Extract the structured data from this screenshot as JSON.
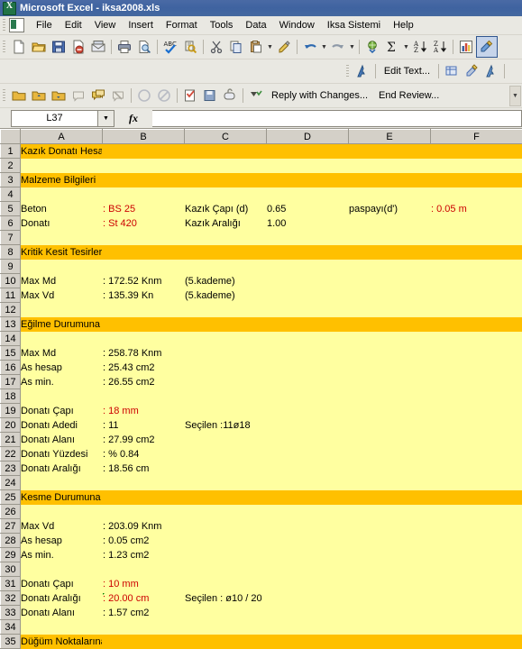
{
  "window": {
    "title": "Microsoft Excel - iksa2008.xls",
    "logo_icon": "excel-logo-icon"
  },
  "menubar": {
    "doc_icon": "document-icon",
    "items": [
      {
        "label": "File"
      },
      {
        "label": "Edit"
      },
      {
        "label": "View"
      },
      {
        "label": "Insert"
      },
      {
        "label": "Format"
      },
      {
        "label": "Tools"
      },
      {
        "label": "Data"
      },
      {
        "label": "Window"
      },
      {
        "label": "Iksa Sistemi"
      },
      {
        "label": "Help"
      }
    ]
  },
  "standard_toolbar": {
    "buttons": [
      {
        "icon": "new-document-icon"
      },
      {
        "icon": "open-folder-icon"
      },
      {
        "icon": "save-icon"
      },
      {
        "icon": "permission-icon"
      },
      {
        "icon": "email-icon"
      },
      {
        "icon": "print-icon"
      },
      {
        "icon": "print-preview-icon"
      },
      {
        "icon": "spelling-check-icon"
      },
      {
        "icon": "research-icon"
      },
      {
        "icon": "cut-scissors-icon"
      },
      {
        "icon": "copy-icon"
      },
      {
        "icon": "paste-icon"
      },
      {
        "icon": "format-painter-icon"
      },
      {
        "icon": "undo-icon"
      },
      {
        "icon": "redo-icon"
      },
      {
        "icon": "hyperlink-icon"
      },
      {
        "icon": "autosum-sigma-icon"
      },
      {
        "icon": "sort-ascending-icon"
      },
      {
        "icon": "sort-descending-icon"
      },
      {
        "icon": "chart-wizard-icon"
      },
      {
        "icon": "drawing-icon"
      }
    ]
  },
  "wordart_toolbar": {
    "shape_icon": "wordart-icon",
    "edit_text_label": "Edit Text...",
    "gallery_icon": "wordart-gallery-icon",
    "format_icon": "format-wordart-icon",
    "shape_letter_icon": "wordart-shape-icon"
  },
  "reviewing_toolbar": {
    "buttons": [
      {
        "icon": "folder-markup-icon"
      },
      {
        "icon": "previous-comment-icon"
      },
      {
        "icon": "next-comment-icon"
      },
      {
        "icon": "show-markup-icon"
      },
      {
        "icon": "comments-icon"
      },
      {
        "icon": "delete-comment-icon"
      },
      {
        "icon": "accept-change-icon"
      },
      {
        "icon": "reject-change-icon"
      },
      {
        "icon": "track-changes-icon"
      },
      {
        "icon": "save-markup-icon"
      },
      {
        "icon": "mail-recipient-icon"
      }
    ],
    "reply_icon": "reply-changes-icon",
    "reply_label": "Reply with Changes...",
    "end_review_label": "End Review..."
  },
  "formula_bar": {
    "name_box_value": "L37",
    "dropdown_icon": "chevron-down-icon",
    "fx_icon": "fx-icon",
    "formula_value": ""
  },
  "sheet": {
    "columns": [
      "A",
      "B",
      "C",
      "D",
      "E",
      "F"
    ],
    "rows": [
      {
        "n": "1",
        "cells": [
          {
            "c": "A",
            "v": "Kazık  Donatı Hesabı",
            "style": "band"
          }
        ]
      },
      {
        "n": "2",
        "cells": []
      },
      {
        "n": "3",
        "cells": [
          {
            "c": "A",
            "v": "Malzeme Bilgileri",
            "style": "band"
          }
        ]
      },
      {
        "n": "4",
        "cells": []
      },
      {
        "n": "5",
        "cells": [
          {
            "c": "A",
            "v": "Beton"
          },
          {
            "c": "B",
            "v": ": BS 25",
            "style": "red"
          },
          {
            "c": "C",
            "v": "Kazık Çapı (d)"
          },
          {
            "c": "D",
            "v": "0.65"
          },
          {
            "c": "E",
            "v": "paspayı(d')"
          },
          {
            "c": "F",
            "v": ": 0.05 m",
            "style": "red"
          }
        ]
      },
      {
        "n": "6",
        "cells": [
          {
            "c": "A",
            "v": "Donatı"
          },
          {
            "c": "B",
            "v": ": St 420",
            "style": "red"
          },
          {
            "c": "C",
            "v": "Kazık Aralığı"
          },
          {
            "c": "D",
            "v": "1.00"
          }
        ]
      },
      {
        "n": "7",
        "cells": []
      },
      {
        "n": "8",
        "cells": [
          {
            "c": "A",
            "v": "Kritik Kesit Tesirleri",
            "style": "band"
          }
        ]
      },
      {
        "n": "9",
        "cells": []
      },
      {
        "n": "10",
        "cells": [
          {
            "c": "A",
            "v": "Max Md"
          },
          {
            "c": "B",
            "v": ": 172.52 Knm"
          },
          {
            "c": "C",
            "v": "(5.kademe)"
          }
        ]
      },
      {
        "n": "11",
        "cells": [
          {
            "c": "A",
            "v": "Max Vd"
          },
          {
            "c": "B",
            "v": ": 135.39 Kn"
          },
          {
            "c": "C",
            "v": "(5.kademe)"
          }
        ]
      },
      {
        "n": "12",
        "cells": []
      },
      {
        "n": "13",
        "cells": [
          {
            "c": "A",
            "v": "Eğilme Durumuna Göre Boyutlandırma",
            "style": "band"
          }
        ]
      },
      {
        "n": "14",
        "cells": []
      },
      {
        "n": "15",
        "cells": [
          {
            "c": "A",
            "v": "Max Md"
          },
          {
            "c": "B",
            "v": ": 258.78 Knm"
          }
        ]
      },
      {
        "n": "16",
        "cells": [
          {
            "c": "A",
            "v": "As hesap"
          },
          {
            "c": "B",
            "v": ": 25.43 cm2"
          }
        ]
      },
      {
        "n": "17",
        "cells": [
          {
            "c": "A",
            "v": "As min."
          },
          {
            "c": "B",
            "v": ": 26.55 cm2"
          }
        ]
      },
      {
        "n": "18",
        "cells": []
      },
      {
        "n": "19",
        "cells": [
          {
            "c": "A",
            "v": "Donatı Çapı"
          },
          {
            "c": "B",
            "v": ": 18 mm",
            "style": "red"
          }
        ]
      },
      {
        "n": "20",
        "cells": [
          {
            "c": "A",
            "v": "Donatı Adedi"
          },
          {
            "c": "B",
            "v": ": 11"
          },
          {
            "c": "C",
            "v": "Seçilen  :11ø18"
          }
        ]
      },
      {
        "n": "21",
        "cells": [
          {
            "c": "A",
            "v": "Donatı Alanı"
          },
          {
            "c": "B",
            "v": ": 27.99 cm2"
          }
        ]
      },
      {
        "n": "22",
        "cells": [
          {
            "c": "A",
            "v": "Donatı Yüzdesi"
          },
          {
            "c": "B",
            "v": ": % 0.84"
          }
        ]
      },
      {
        "n": "23",
        "cells": [
          {
            "c": "A",
            "v": "Donatı Aralığı"
          },
          {
            "c": "B",
            "v": ": 18.56 cm"
          }
        ]
      },
      {
        "n": "24",
        "cells": []
      },
      {
        "n": "25",
        "cells": [
          {
            "c": "A",
            "v": "Kesme Durumuna Göre Boyutlandırma",
            "style": "band"
          }
        ]
      },
      {
        "n": "26",
        "cells": []
      },
      {
        "n": "27",
        "cells": [
          {
            "c": "A",
            "v": "Max Vd"
          },
          {
            "c": "B",
            "v": ": 203.09 Knm"
          }
        ]
      },
      {
        "n": "28",
        "cells": [
          {
            "c": "A",
            "v": "As hesap"
          },
          {
            "c": "B",
            "v": ": 0.05 cm2"
          }
        ]
      },
      {
        "n": "29",
        "cells": [
          {
            "c": "A",
            "v": "As min."
          },
          {
            "c": "B",
            "v": ": 1.23 cm2"
          }
        ]
      },
      {
        "n": "30",
        "cells": []
      },
      {
        "n": "31",
        "cells": [
          {
            "c": "A",
            "v": "Donatı Çapı"
          },
          {
            "c": "B",
            "v": ": 10 mm",
            "style": "red"
          }
        ]
      },
      {
        "n": "32",
        "cells": [
          {
            "c": "A",
            "v": "Donatı Aralığı"
          },
          {
            "c": "B",
            "v": ": 20.00 cm",
            "style": "red",
            "comment": true
          },
          {
            "c": "C",
            "v": "Seçilen :  ø10 / 20"
          }
        ]
      },
      {
        "n": "33",
        "cells": [
          {
            "c": "A",
            "v": "Donatı Alanı"
          },
          {
            "c": "B",
            "v": ": 1.57 cm2"
          }
        ]
      },
      {
        "n": "34",
        "cells": []
      },
      {
        "n": "35",
        "cells": [
          {
            "c": "A",
            "v": "Düğüm Noktalarına Göre Boyutlandırma",
            "style": "band"
          }
        ]
      }
    ]
  },
  "colors": {
    "cell_fill": "#ffffa0",
    "band_fill": "#ffc000",
    "accent_red": "#cc0000",
    "titlebar": "#41659f"
  }
}
